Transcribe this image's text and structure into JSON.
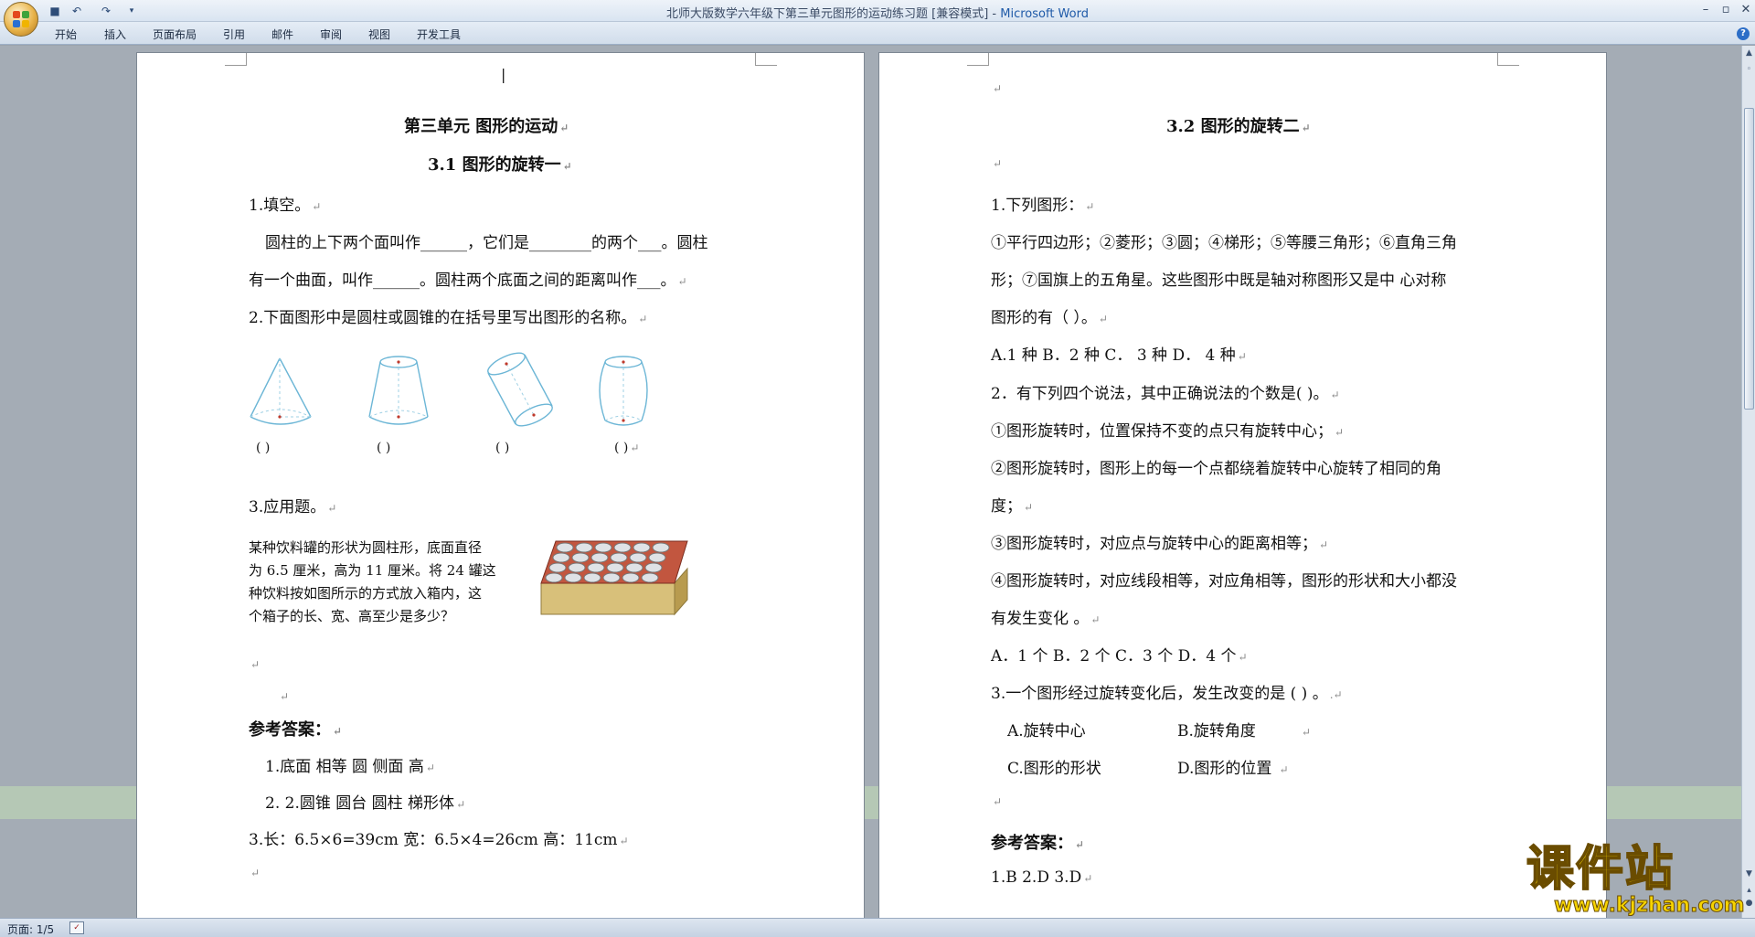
{
  "window": {
    "title": "北师大版数学六年级下第三单元图形的运动练习题 [兼容模式] - ",
    "app_name": "Microsoft Word",
    "quick_access": [
      "save-icon",
      "undo-icon",
      "redo-icon",
      "customize-icon"
    ]
  },
  "ribbon": {
    "tabs": [
      "开始",
      "插入",
      "页面布局",
      "引用",
      "邮件",
      "审阅",
      "视图",
      "开发工具"
    ],
    "help_label": "?"
  },
  "page_left": {
    "cursor": "|",
    "unit_title": "第三单元    图形的运动",
    "lesson_title": "3.1 图形的旋转一",
    "q1_title": "1.填空。",
    "q1_line1": "圆柱的上下两个面叫作______，它们是________的两个___。圆柱",
    "q1_line2": "有一个曲面，叫作______。圆柱两个底面之间的距离叫作___。",
    "q2_title": "2.下面图形中是圆柱或圆锥的在括号里写出图形的名称。",
    "shape_blanks": [
      "(    )",
      "(    )",
      "(    )",
      "(    )"
    ],
    "q3_title": "3.应用题。",
    "q3_text": [
      "某种饮料罐的形状为圆柱形，底面直径",
      "为 6.5 厘米，高为 11 厘米。将 24 罐这",
      "种饮料按如图所示的方式放入箱内，这",
      "个箱子的长、宽、高至少是多少？"
    ],
    "answer_title": "参考答案：",
    "answers": [
      "1.底面    相等    圆    侧面    高",
      "2.  2.圆锥    圆台    圆柱      梯形体",
      "3.长：6.5×6=39cm      宽：6.5×4=26cm      高：11cm"
    ]
  },
  "page_right": {
    "lesson_title": "3.2 图形的旋转二",
    "q1_title": "1.下列图形：",
    "q1_line1": "①平行四边形；②菱形；③圆；④梯形；⑤等腰三角形；⑥直角三角",
    "q1_line2": "形；⑦国旗上的五角星。这些图形中既是轴对称图形又是中  心对称",
    "q1_line3": "图形的有（ ）。",
    "q1_options": "A.1 种        B．2 种        C．  3 种      D．  4 种",
    "q2_title": " 2．有下列四个说法，其中正确说法的个数是(      )。",
    "q2_items": [
      "①图形旋转时，位置保持不变的点只有旋转中心；",
      "②图形旋转时，图形上的每一个点都绕着旋转中心旋转了相同的角",
      "度；",
      "③图形旋转时，对应点与旋转中心的距离相等；",
      "④图形旋转时，对应线段相等，对应角相等，图形的形状和大小都没",
      "有发生变化 。"
    ],
    "q2_options": "A．1 个    B．2 个     C．3 个        D．4 个",
    "q3_title": "3.一个图形经过旋转变化后，发生改变的是 (      ) 。",
    "q3_options_row1": [
      "A.旋转中心",
      "B.旋转角度"
    ],
    "q3_options_row2": [
      "C.图形的形状",
      "D.图形的位置"
    ],
    "answer_title": "参考答案：",
    "answers": "1.B             2.D            3.D"
  },
  "status_bar": {
    "page_info": "页面: 1/5"
  },
  "watermark": {
    "brand": "课件站",
    "url": "www.kjzhan.com"
  },
  "colors": {
    "word_blue": "#1f5aa8",
    "workspace_gray": "#a4acb5",
    "watermark_yellow": "#f6d400"
  }
}
